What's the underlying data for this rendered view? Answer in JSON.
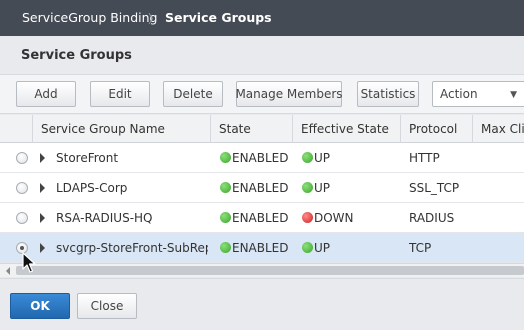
{
  "breadcrumb": {
    "parent": "ServiceGroup Binding",
    "separator": "〉",
    "current": "Service Groups"
  },
  "panel": {
    "title": "Service Groups"
  },
  "toolbar": {
    "add": "Add",
    "edit": "Edit",
    "delete": "Delete",
    "manage_members": "Manage Members",
    "statistics": "Statistics",
    "action": "Action"
  },
  "table": {
    "columns": {
      "name": "Service Group Name",
      "state": "State",
      "effective_state": "Effective State",
      "protocol": "Protocol",
      "max_clients": "Max Cli"
    },
    "rows": [
      {
        "name": "StoreFront",
        "state": "ENABLED",
        "effective_state": "UP",
        "protocol": "HTTP",
        "selected": false
      },
      {
        "name": "LDAPS-Corp",
        "state": "ENABLED",
        "effective_state": "UP",
        "protocol": "SSL_TCP",
        "selected": false
      },
      {
        "name": "RSA-RADIUS-HQ",
        "state": "ENABLED",
        "effective_state": "DOWN",
        "protocol": "RADIUS",
        "selected": false
      },
      {
        "name": "svcgrp-StoreFront-SubRepl",
        "state": "ENABLED",
        "effective_state": "UP",
        "protocol": "TCP",
        "selected": true
      }
    ]
  },
  "footer": {
    "ok": "OK",
    "close": "Close"
  },
  "colors": {
    "topbar": "#454b54",
    "primary_button": "#2a78c4",
    "status_up": "#3aa52a",
    "status_down": "#d12020",
    "selected_row": "#d8e6f5"
  },
  "icons": {
    "expand": "chevron-right-icon",
    "status": "status-dot-icon",
    "cursor": "mouse-pointer-icon"
  }
}
